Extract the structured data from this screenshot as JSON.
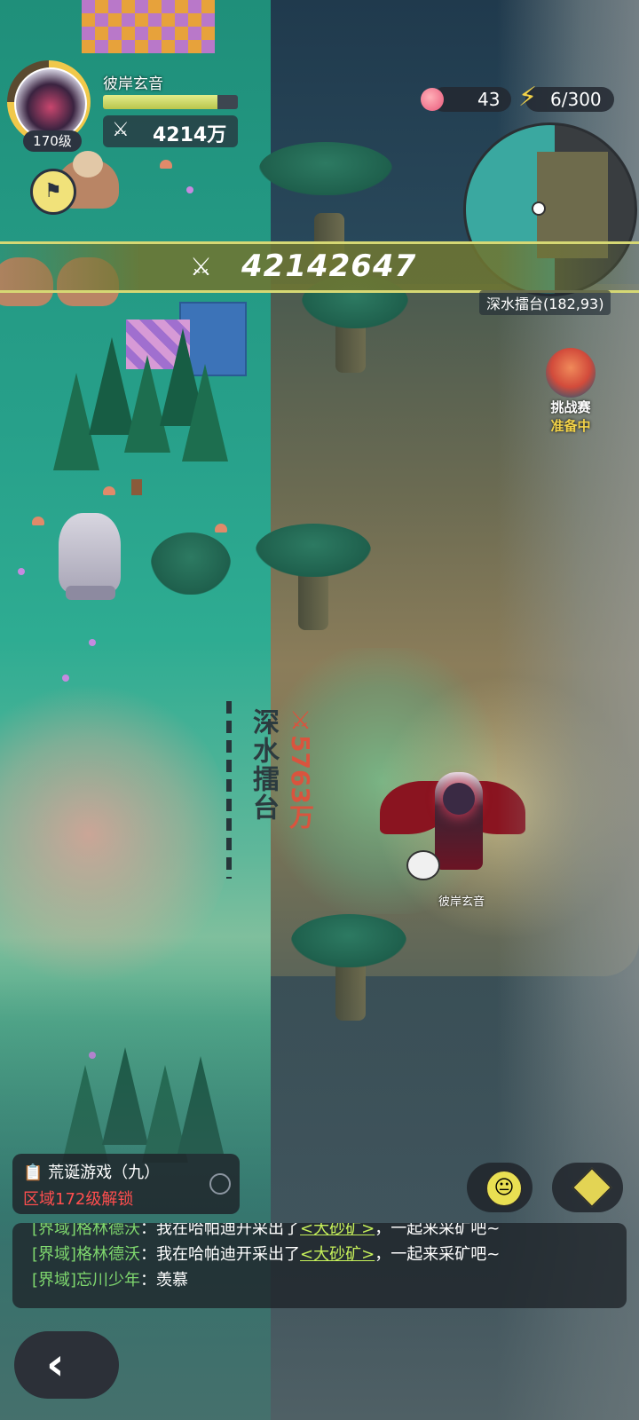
{
  "player": {
    "name": "彼岸玄音",
    "level_label": "170级",
    "power_label": "4214万",
    "xp_fraction": 0.85
  },
  "resources": {
    "peach_count": "43",
    "energy": "6/300"
  },
  "power_banner": {
    "value": "42142647"
  },
  "minimap": {
    "location_label": "深水擂台(182,93)"
  },
  "event": {
    "title": "挑战赛",
    "status": "准备中"
  },
  "map": {
    "zone_name": "深水擂台",
    "zone_power": "5763万",
    "character_name": "彼岸玄音"
  },
  "quest": {
    "title": "荒诞游戏（九）",
    "subtitle": "区域172级解锁"
  },
  "chat": {
    "lines": [
      {
        "channel": "[界域]",
        "user": "格林德沃",
        "sep": "：",
        "pre": "我在哈帕迪开采出了",
        "item": "<大砂矿>",
        "post": "，一起来采矿吧~"
      },
      {
        "channel": "[界域]",
        "user": "格林德沃",
        "sep": "：",
        "pre": "我在哈帕迪开采出了",
        "item": "<大砂矿>",
        "post": "，一起来采矿吧~"
      },
      {
        "channel": "[界域]",
        "user": "忘川少年",
        "sep": "：",
        "pre": "羡慕",
        "item": "",
        "post": ""
      }
    ]
  },
  "colors": {
    "accent_yellow": "#f2d248",
    "unlock_red": "#ff4e4e",
    "chat_green": "#7fd86e"
  },
  "icons": {
    "flag": "flag-icon",
    "peach": "peach-icon",
    "energy": "lightning-icon",
    "power": "crossed-swords-icon",
    "quest": "clipboard-icon",
    "emoji": "smiley-icon",
    "bag": "cube-icon",
    "back": "chevron-left-icon"
  }
}
